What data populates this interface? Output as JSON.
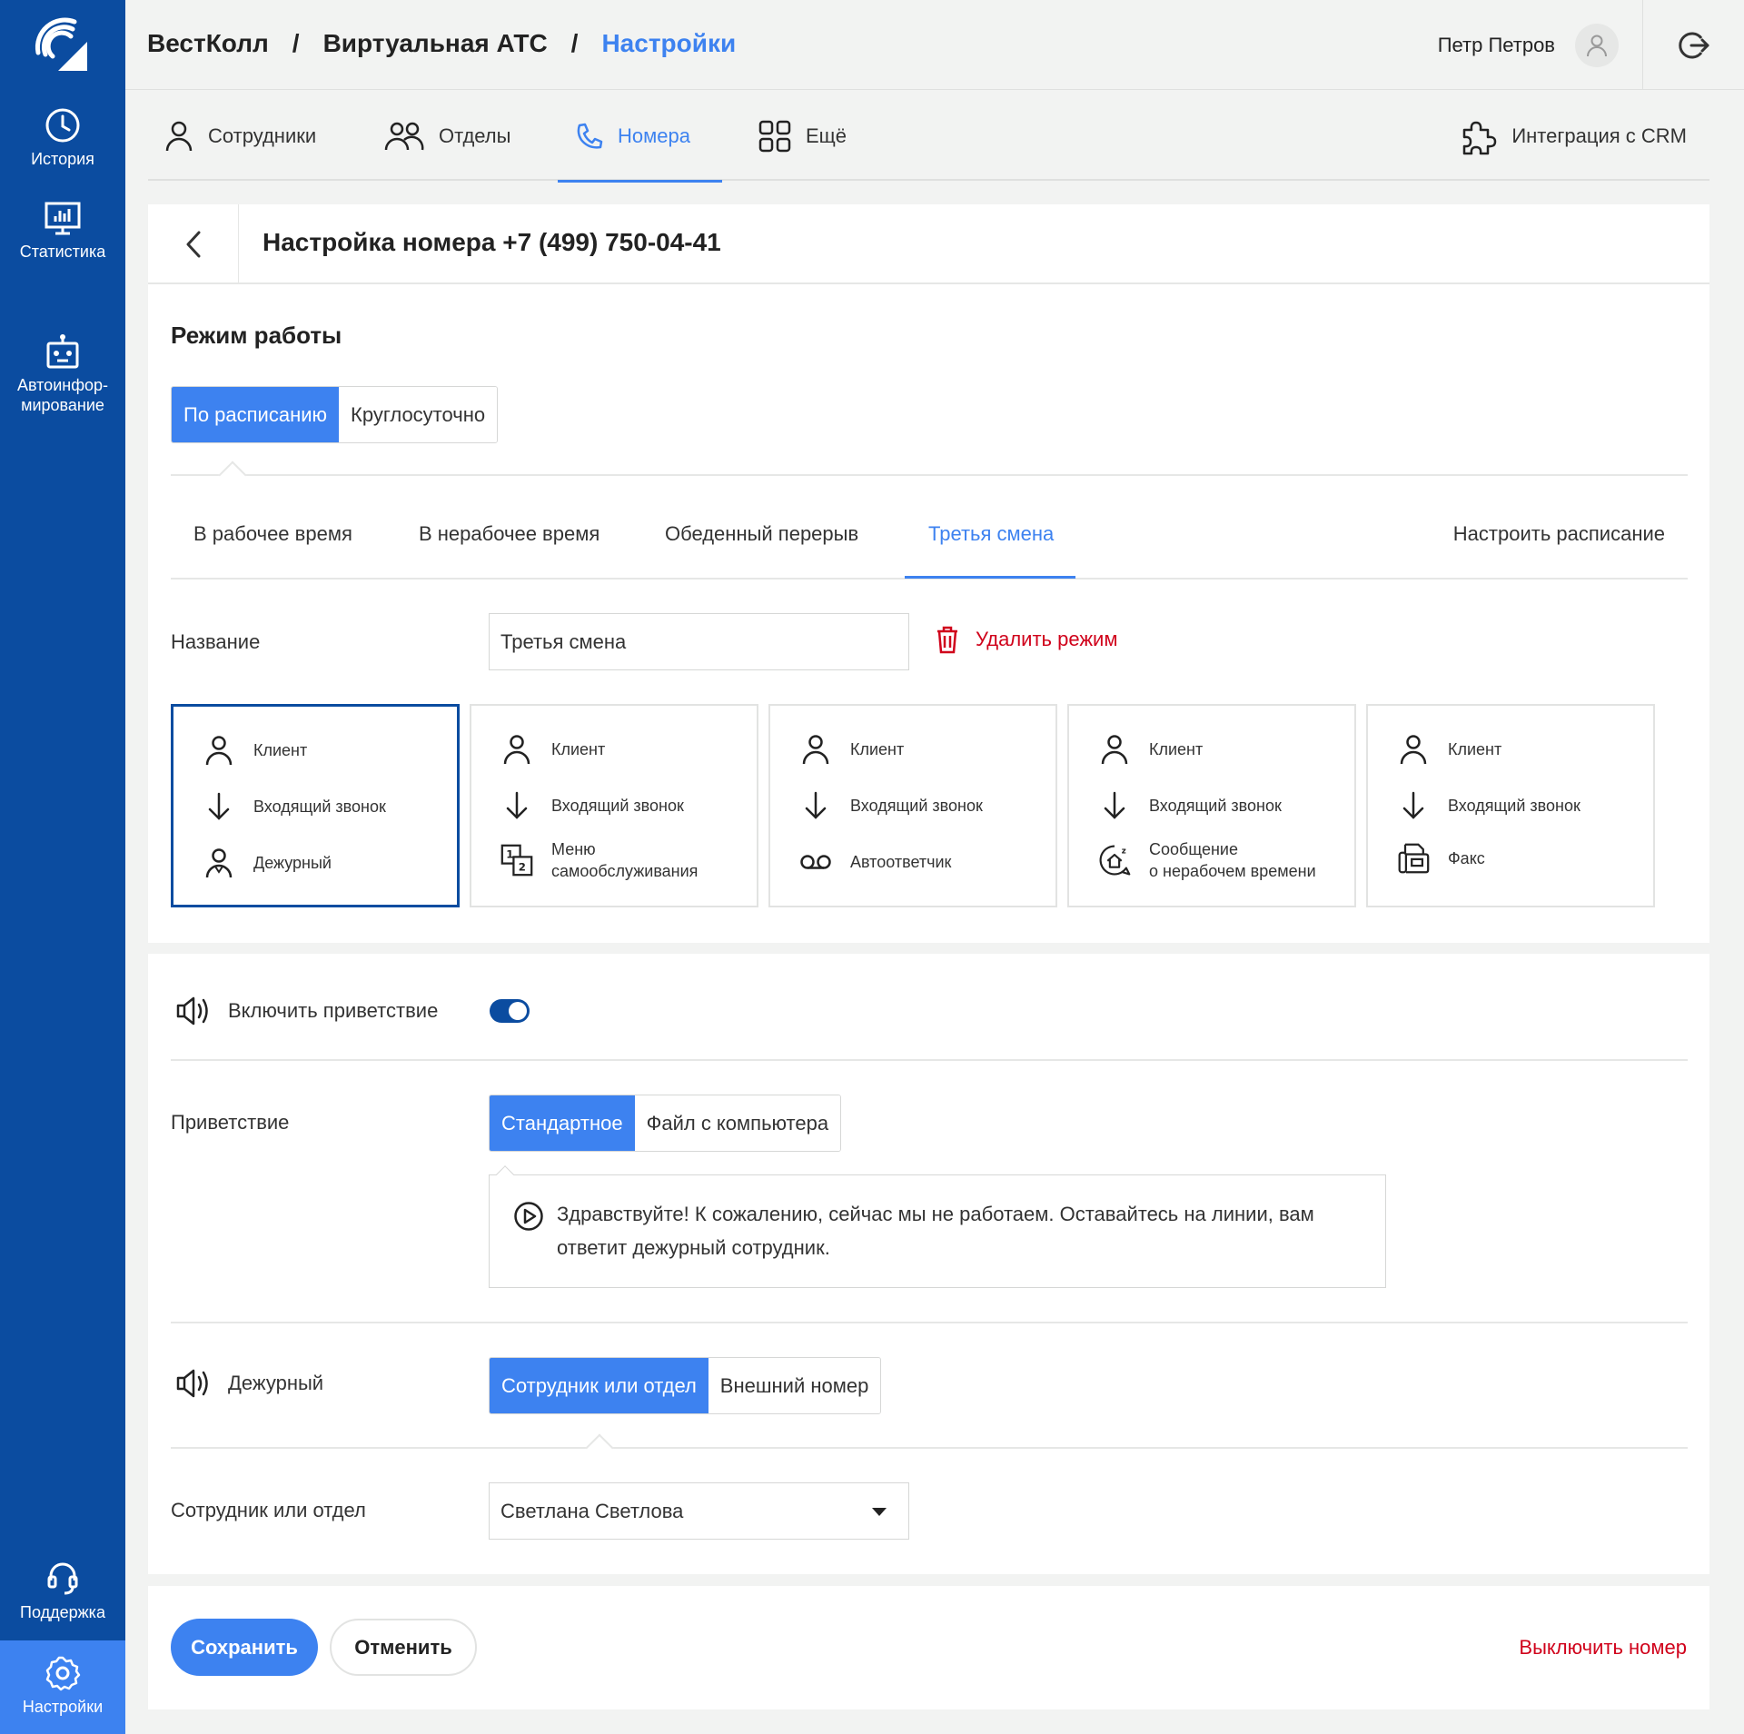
{
  "sidebar": {
    "items": [
      {
        "label": "История",
        "icon": "clock-icon"
      },
      {
        "label": "Статистика",
        "icon": "monitor-chart-icon"
      },
      {
        "label": "Автоинфор-\nмирование",
        "icon": "robot-icon"
      },
      {
        "label": "Поддержка",
        "icon": "headset-icon"
      },
      {
        "label": "Настройки",
        "icon": "gear-icon"
      }
    ],
    "accent": "#0b4ca0",
    "active_color": "#3d82f0"
  },
  "header": {
    "breadcrumbs": [
      "ВестКолл",
      "Виртуальная АТС",
      "Настройки"
    ],
    "separator": "/",
    "user_name": "Петр Петров"
  },
  "nav": {
    "tabs": [
      {
        "label": "Сотрудники",
        "icon": "user-icon"
      },
      {
        "label": "Отделы",
        "icon": "users-icon"
      },
      {
        "label": "Номера",
        "icon": "phone-icon",
        "active": true
      },
      {
        "label": "Ещё",
        "icon": "grid-icon"
      }
    ],
    "crm": {
      "label": "Интеграция с CRM",
      "icon": "puzzle-icon"
    }
  },
  "page": {
    "title": "Настройка номера +7 (499) 750-04-41"
  },
  "mode": {
    "heading": "Режим работы",
    "options": [
      "По расписанию",
      "Круглосуточно"
    ],
    "selected": "По расписанию",
    "subtabs": [
      "В рабочее время",
      "В нерабочее время",
      "Обеденный перерыв",
      "Третья смена"
    ],
    "active_subtab": "Третья смена",
    "schedule_link": "Настроить расписание",
    "name_label": "Название",
    "name_value": "Третья смена",
    "delete_label": "Удалить режим"
  },
  "scenarios": [
    {
      "rows": [
        "Клиент",
        "Входящий звонок",
        "Дежурный"
      ],
      "selected": true
    },
    {
      "rows": [
        "Клиент",
        "Входящий звонок",
        "Меню\nсамообслуживания"
      ]
    },
    {
      "rows": [
        "Клиент",
        "Входящий звонок",
        "Автоответчик"
      ]
    },
    {
      "rows": [
        "Клиент",
        "Входящий звонок",
        "Сообщение\nо нерабочем времени"
      ]
    },
    {
      "rows": [
        "Клиент",
        "Входящий звонок",
        "Факс"
      ]
    }
  ],
  "greeting": {
    "toggle_label": "Включить приветствие",
    "enabled": true,
    "label": "Приветствие",
    "options": [
      "Стандартное",
      "Файл с компьютера"
    ],
    "selected": "Стандартное",
    "text": "Здравствуйте! К сожалению, сейчас мы не работаем. Оставайтесь на линии, вам ответит дежурный сотрудник."
  },
  "duty": {
    "label": "Дежурный",
    "options": [
      "Сотрудник или отдел",
      "Внешний номер"
    ],
    "selected": "Сотрудник или отдел",
    "select_label": "Сотрудник или отдел",
    "select_value": "Светлана Светлова"
  },
  "footer": {
    "save": "Сохранить",
    "cancel": "Отменить",
    "disable": "Выключить номер"
  }
}
